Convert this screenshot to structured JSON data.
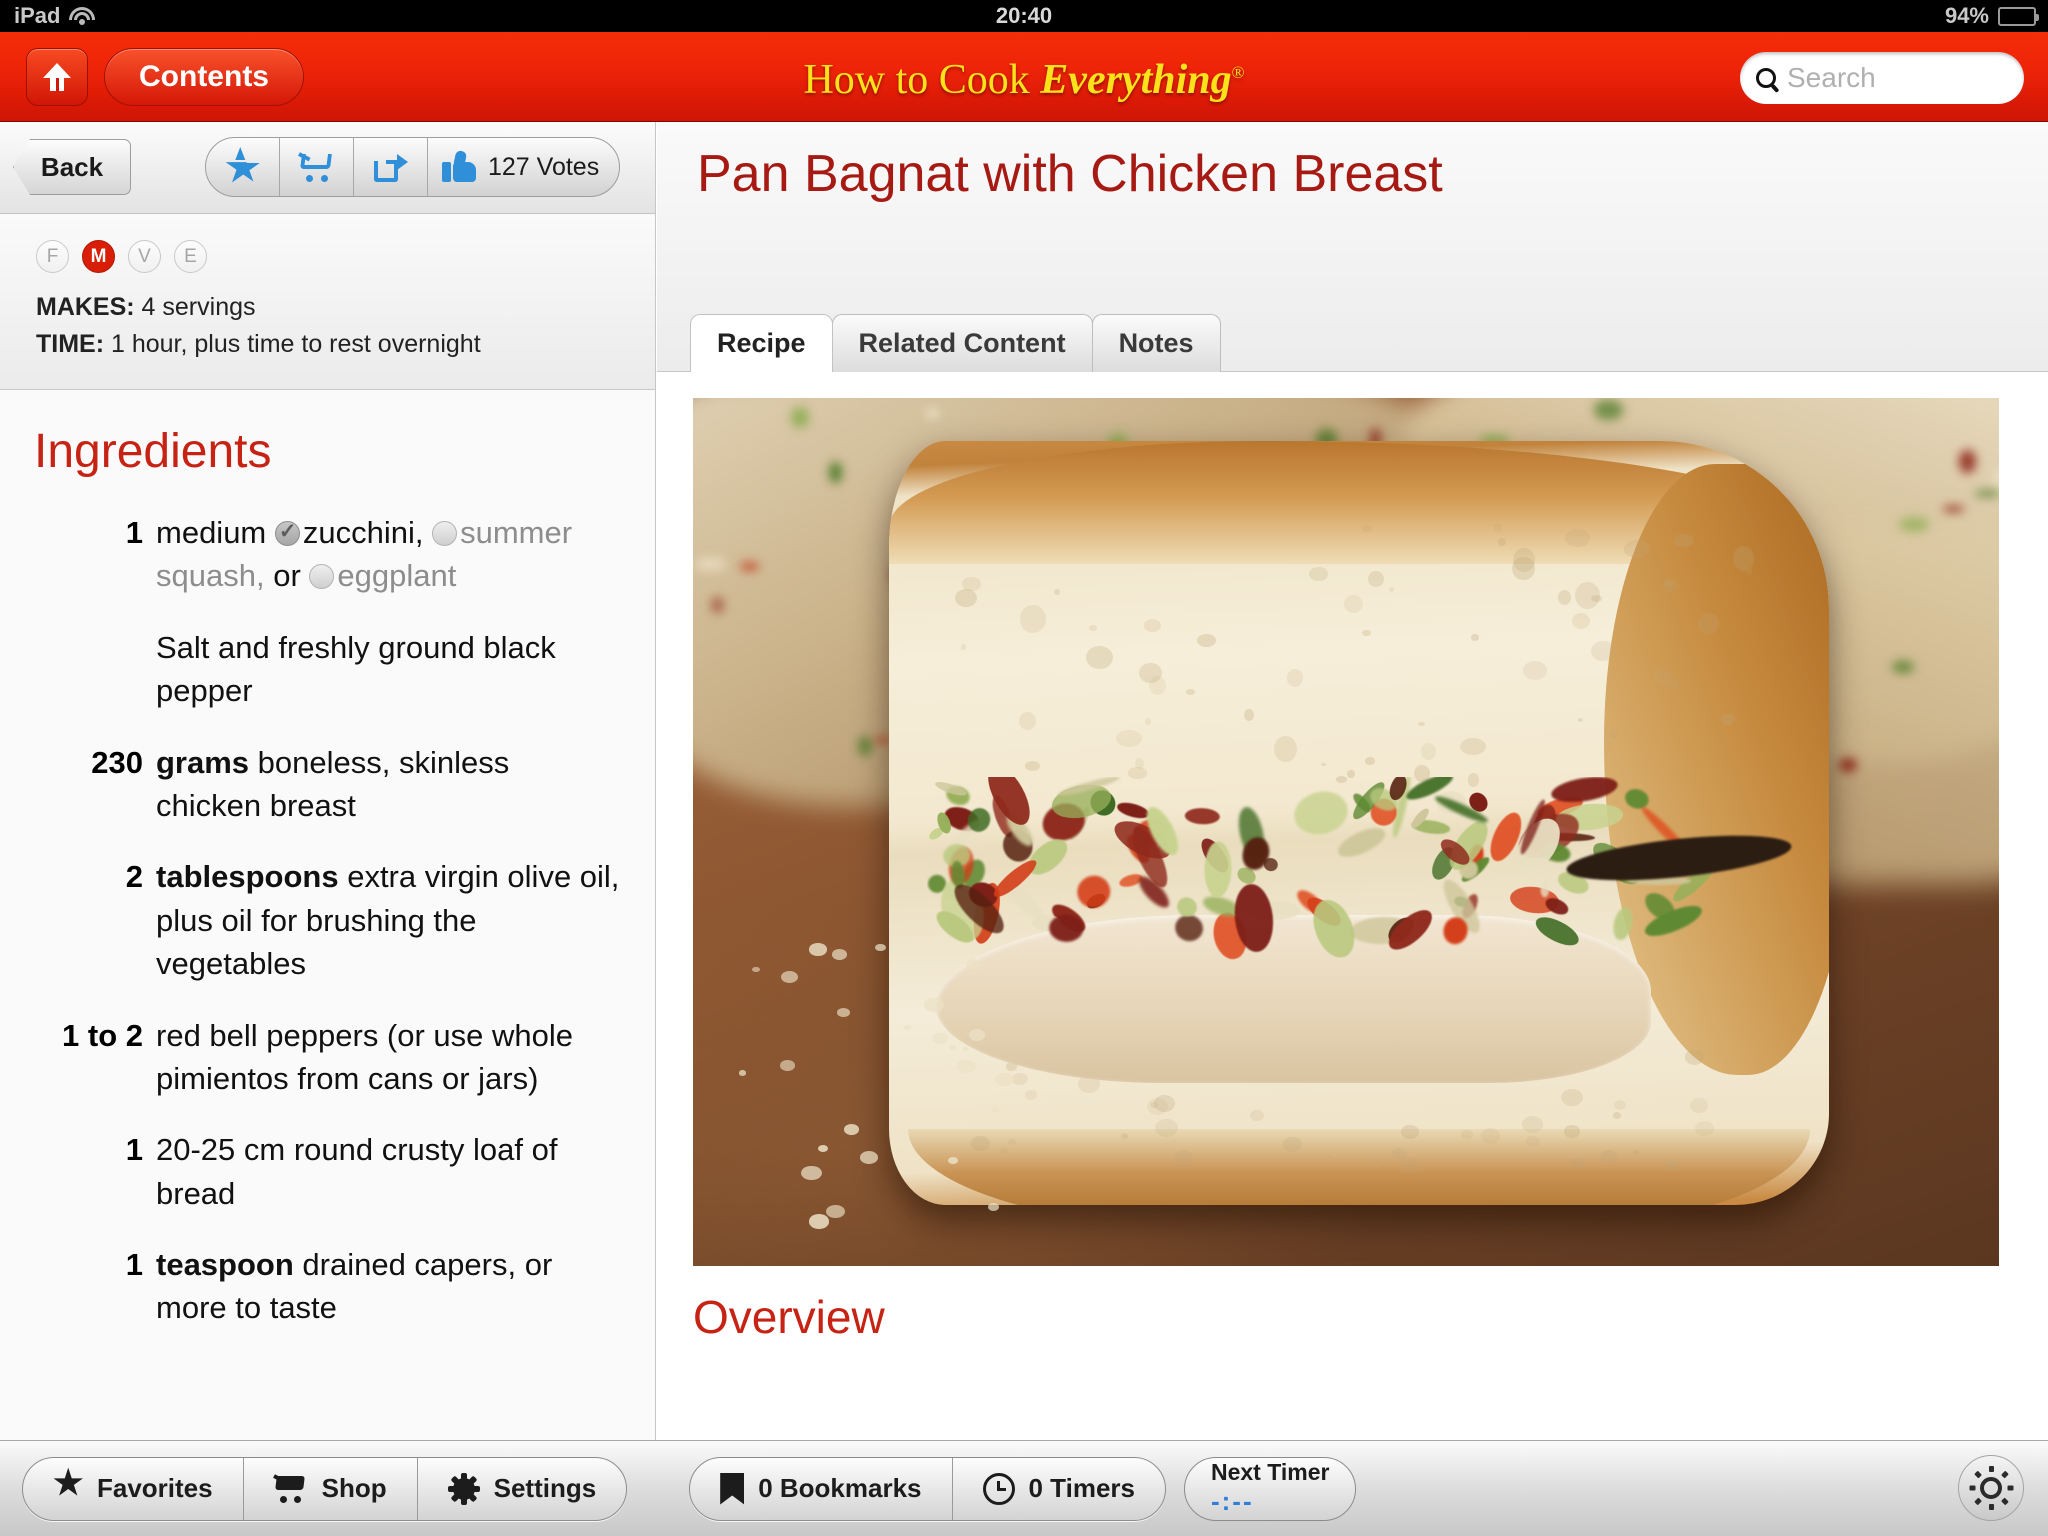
{
  "status_bar": {
    "device": "iPad",
    "wifi_icon": "wifi-icon",
    "time": "20:40",
    "battery_percent": "94%",
    "battery_icon": "battery-icon"
  },
  "nav": {
    "home_icon": "home-icon",
    "contents_label": "Contents",
    "brand_prefix": "How to Cook ",
    "brand_italic": "Everything",
    "brand_registered": "®",
    "search_icon": "search-icon",
    "search_placeholder": "Search",
    "search_value": ""
  },
  "toolbar": {
    "back_label": "Back",
    "favorite_icon": "star-icon",
    "cart_icon": "shopping-cart-icon",
    "share_icon": "share-icon",
    "thumb_icon": "thumbs-up-icon",
    "votes_label": "127 Votes"
  },
  "meta": {
    "badges": [
      {
        "letter": "F",
        "active": false
      },
      {
        "letter": "M",
        "active": true
      },
      {
        "letter": "V",
        "active": false
      },
      {
        "letter": "E",
        "active": false
      }
    ],
    "makes_label": "MAKES:",
    "makes_value": " 4 servings",
    "time_label": "TIME:",
    "time_value": " 1 hour, plus time to rest overnight"
  },
  "ingredients": {
    "heading": "Ingredients",
    "items": [
      {
        "qty": "1",
        "qty_bold": true,
        "parts": [
          {
            "text": "medium ",
            "dim": false
          },
          {
            "radio": "selected"
          },
          {
            "text": "zucchini, ",
            "dim": false
          },
          {
            "radio": "empty"
          },
          {
            "text": "summer squash, ",
            "dim": true
          },
          {
            "text": "or ",
            "dim": false
          },
          {
            "radio": "empty"
          },
          {
            "text": "eggplant",
            "dim": true
          }
        ]
      },
      {
        "qty": "",
        "qty_bold": false,
        "parts": [
          {
            "text": "Salt and freshly ground black pepper",
            "dim": false
          }
        ]
      },
      {
        "qty": "230",
        "qty_bold": true,
        "parts": [
          {
            "text": "grams ",
            "dim": false,
            "bold": true
          },
          {
            "text": "boneless, skinless chicken breast",
            "dim": false
          }
        ]
      },
      {
        "qty": "2",
        "qty_bold": true,
        "parts": [
          {
            "text": "tablespoons ",
            "dim": false,
            "bold": true
          },
          {
            "text": "extra virgin olive oil, plus oil for brushing the vegetables",
            "dim": false
          }
        ]
      },
      {
        "qty": "1 to 2",
        "qty_bold": true,
        "parts": [
          {
            "text": "red bell peppers (or use whole pimientos from cans or jars)",
            "dim": false
          }
        ]
      },
      {
        "qty": "1",
        "qty_bold": true,
        "parts": [
          {
            "text": "20-25 cm round crusty loaf of bread",
            "dim": false
          }
        ]
      },
      {
        "qty": "1",
        "qty_bold": true,
        "parts": [
          {
            "text": "teaspoon ",
            "dim": false,
            "bold": true
          },
          {
            "text": "drained capers, or more to taste",
            "dim": false
          }
        ]
      }
    ]
  },
  "recipe": {
    "title": "Pan Bagnat with Chicken Breast",
    "tabs": [
      {
        "label": "Recipe",
        "active": true
      },
      {
        "label": "Related Content",
        "active": false
      },
      {
        "label": "Notes",
        "active": false
      }
    ],
    "photo_alt": "pan-bagnat-sandwich-photo",
    "overview_heading": "Overview"
  },
  "bottom_bar": {
    "favorites_label": "Favorites",
    "favorites_icon": "star-icon",
    "shop_label": "Shop",
    "shop_icon": "shopping-cart-icon",
    "settings_label": "Settings",
    "settings_icon": "gear-icon",
    "bookmarks_label": "0 Bookmarks",
    "bookmarks_icon": "bookmark-icon",
    "timers_label": "0 Timers",
    "timers_icon": "clock-icon",
    "next_timer_label": "Next Timer",
    "next_timer_value": "-:--",
    "brightness_icon": "brightness-sun-icon"
  },
  "colors": {
    "brand_red": "#ef2408",
    "title_red": "#a61a13",
    "heading_red": "#c62314",
    "accent_blue": "#2f8fd8",
    "badge_active": "#d81e06"
  }
}
